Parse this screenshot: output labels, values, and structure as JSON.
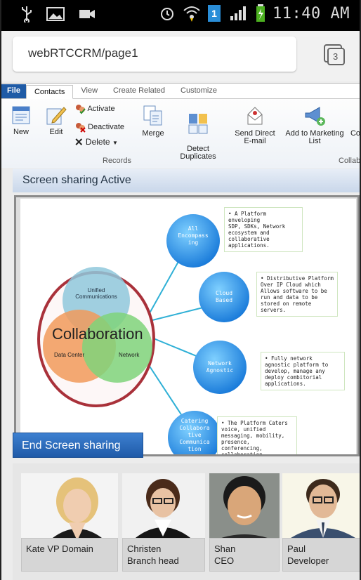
{
  "status_bar": {
    "time": "11:40 AM",
    "battery_level": "1"
  },
  "url_bar": {
    "url": "webRTCCRM/page1",
    "tab_count": "3"
  },
  "ribbon": {
    "tabs": [
      "File",
      "Contacts",
      "View",
      "Create Related",
      "Customize"
    ],
    "active_tab": "Contacts",
    "commands": {
      "new": "New",
      "edit": "Edit",
      "activate": "Activate",
      "deactivate": "Deactivate",
      "delete": "Delete",
      "merge": "Merge",
      "detect_duplicates": "Detect\nDuplicates",
      "send_direct_email": "Send Direct\nE-mail",
      "add_to_marketing_list": "Add to Marketing\nList",
      "truncated": "Co"
    },
    "groups": {
      "records": "Records",
      "collab": "Collab"
    }
  },
  "screen_share": {
    "status": "Screen sharing Active",
    "end_button": "End Screen sharing",
    "slide": {
      "center_title": "Collaboration",
      "unified": "Unified\nCommunications",
      "data_center": "Data Center",
      "network": "Network",
      "nodes": [
        {
          "label": "All\nEncompass\ning",
          "note": "• A Platform enveloping\nSDP, SDKs, Network\necosystem and\ncollaborative\napplications."
        },
        {
          "label": "Cloud\nBased",
          "note": "• Distributive Platform\nOver IP Cloud which\nAllows software to be\nrun and data to be\nstored on remote\nservers."
        },
        {
          "label": "Network\nAgnostic",
          "note": "• Fully network\nagnostic platform to\ndevelop, manage any\ndeploy combitorial\napplications."
        },
        {
          "label": "Catering\nCollabora\ntive\nCommunica\ntion",
          "note": "• The Platform Caters\nvoice, unified\nmessaging, mobility,\npresence, conferencing,\ncollaboration,\napplications and more"
        }
      ]
    }
  },
  "participants": [
    {
      "label": "Kate VP Domain"
    },
    {
      "label": "Christen\nBranch head"
    },
    {
      "label": "Shan\nCEO"
    },
    {
      "label": "Paul\nDeveloper"
    }
  ],
  "colors": {
    "ribbon_file": "#1f5ba6",
    "end_button": "#2f6cbf",
    "share_bar": "#d4e0ef"
  }
}
